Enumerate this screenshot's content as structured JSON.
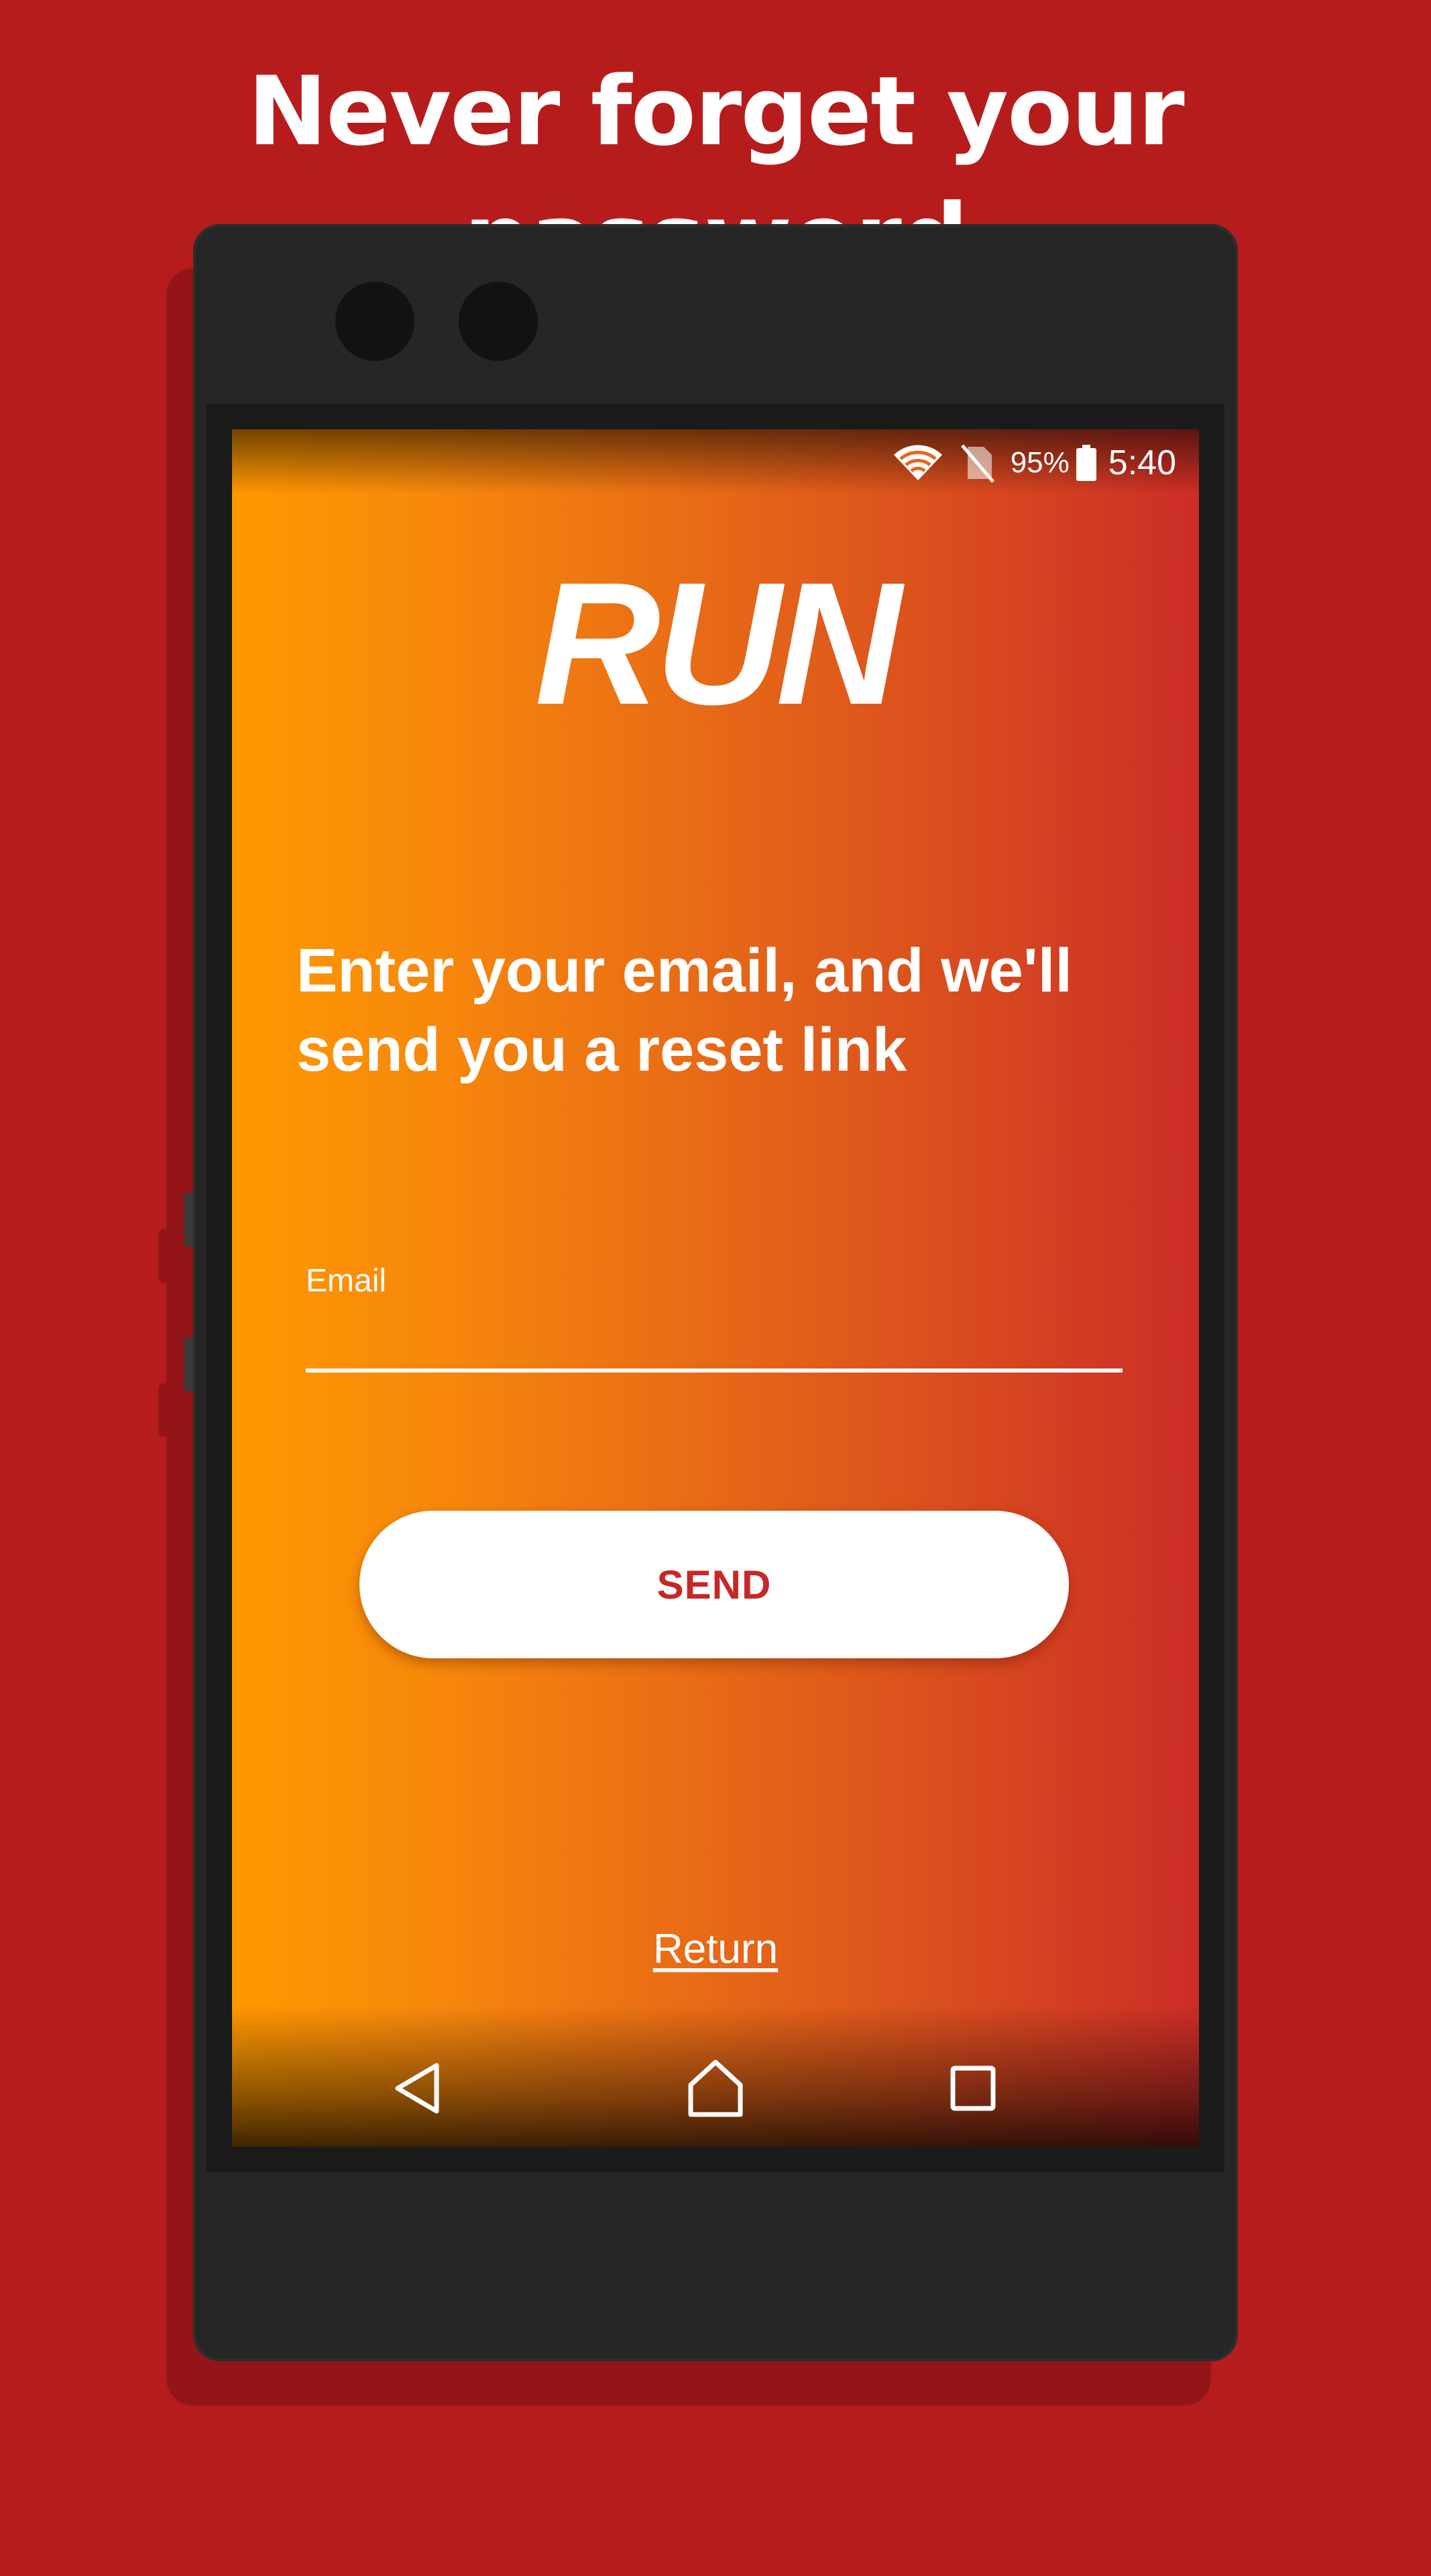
{
  "promo": {
    "headline": "Never forget your password"
  },
  "status_bar": {
    "wifi_icon": "wifi-icon",
    "sim_icon": "no-sim-icon",
    "battery_percent": "95%",
    "battery_icon": "battery-icon",
    "time": "5:40"
  },
  "app": {
    "logo_text": "RUN",
    "instruction": "Enter your email, and we'll send you a reset link",
    "email": {
      "label": "Email",
      "value": ""
    },
    "send_button_label": "SEND",
    "return_link": "Return"
  },
  "nav_bar": {
    "back_icon": "back-triangle-icon",
    "home_icon": "home-icon",
    "recents_icon": "recents-square-icon"
  },
  "colors": {
    "background": "#b71c1c",
    "phone_body": "#262626",
    "gradient_start": "#ff9800",
    "gradient_end": "#cc2d26",
    "button_text": "#c62828",
    "text": "#ffffff"
  }
}
